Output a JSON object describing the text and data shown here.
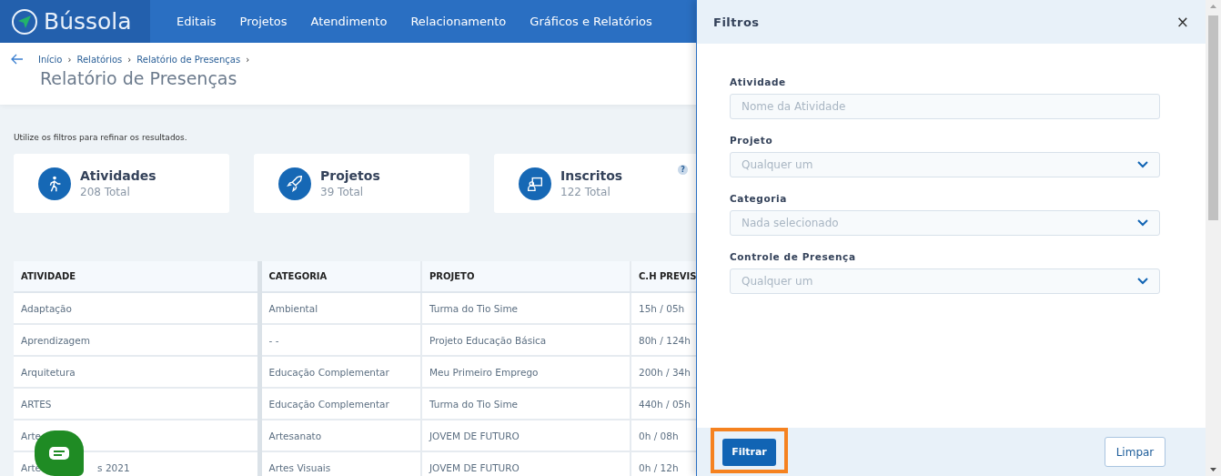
{
  "nav": {
    "brand": "Bússola",
    "items": [
      "Editais",
      "Projetos",
      "Atendimento",
      "Relacionamento",
      "Gráficos e Relatórios"
    ]
  },
  "breadcrumb": [
    "Início",
    "Relatórios",
    "Relatório de Presenças"
  ],
  "breadcrumb_separator": "›",
  "page_title": "Relatório de Presenças",
  "hint": "Utilize os filtros para refinar os resultados.",
  "stats": [
    {
      "kind": "activity",
      "title": "Atividades",
      "total": "208 Total"
    },
    {
      "kind": "project",
      "title": "Projetos",
      "total": "39 Total"
    },
    {
      "kind": "enrolled",
      "title": "Inscritos",
      "total": "122 Total",
      "help": "?"
    }
  ],
  "table": {
    "columns": [
      "ATIVIDADE",
      "CATEGORIA",
      "PROJETO",
      "C.H PREVIS"
    ],
    "rows": [
      [
        "Adaptação",
        "Ambiental",
        "Turma do Tio Sime",
        "15h / 05h"
      ],
      [
        "Aprendizagem",
        "- -",
        "Projeto Educação Básica",
        "80h / 124h"
      ],
      [
        "Arquitetura",
        "Educação Complementar",
        "Meu Primeiro Emprego",
        "200h / 34h"
      ],
      [
        "ARTES",
        "Educação Complementar",
        "Turma do Tio Sime",
        "440h / 05h"
      ],
      [
        "Arte",
        "Artesanato",
        "JOVEM DE FUTURO",
        "0h / 08h"
      ],
      [
        [
          "Arte",
          "s 2021"
        ],
        "Artes Visuais",
        "JOVEM DE FUTURO",
        "0h / 12h"
      ]
    ]
  },
  "filters": {
    "title": "Filtros",
    "close": "×",
    "fields": [
      {
        "kind": "text",
        "label": "Atividade",
        "placeholder": "Nome da Atividade"
      },
      {
        "kind": "select",
        "label": "Projeto",
        "placeholder": "Qualquer um"
      },
      {
        "kind": "select",
        "label": "Categoria",
        "placeholder": "Nada selecionado"
      },
      {
        "kind": "select",
        "label": "Controle de Presença",
        "placeholder": "Qualquer um"
      }
    ],
    "apply": "Filtrar",
    "clear": "Limpar"
  }
}
